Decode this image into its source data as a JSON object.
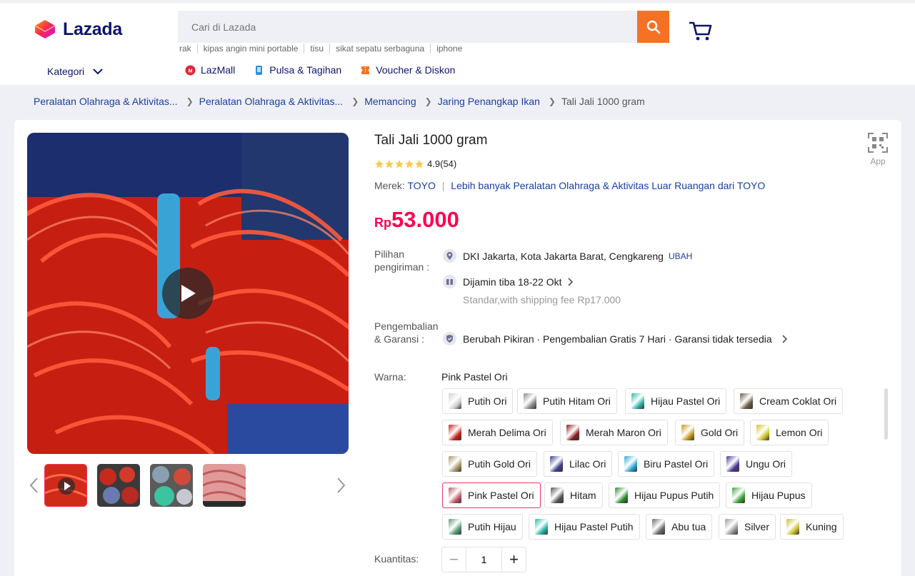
{
  "header": {
    "brand": "Lazada",
    "search": {
      "placeholder": "Cari di Lazada"
    },
    "suggestions": [
      "rak",
      "kipas angin mini portable",
      "tisu",
      "sikat sepatu serbaguna",
      "iphone"
    ],
    "kategori": "Kategori",
    "nav": [
      {
        "label": "LazMall",
        "icon": "lazmall-icon",
        "color": "#e0263a"
      },
      {
        "label": "Pulsa & Tagihan",
        "icon": "phone-icon",
        "color": "#2a8ee8"
      },
      {
        "label": "Voucher & Diskon",
        "icon": "voucher-icon",
        "color": "#f57224"
      }
    ]
  },
  "breadcrumb": [
    "Peralatan Olahraga & Aktivitas...",
    "Peralatan Olahraga & Aktivitas...",
    "Memancing",
    "Jaring Penangkap Ikan",
    "Tali Jali 1000 gram"
  ],
  "product": {
    "title": "Tali Jali 1000 gram",
    "rating_value": 4.9,
    "rating_text": "4.9(54)",
    "brand_label": "Merek:",
    "brand": "TOYO",
    "more_from": "Lebih banyak Peralatan Olahraga & Aktivitas Luar Ruangan dari TOYO",
    "price_currency": "Rp",
    "price_value": "53.000",
    "app_label": "App"
  },
  "delivery": {
    "label": "Pilihan pengiriman :",
    "location": "DKI Jakarta, Kota Jakarta Barat, Cengkareng",
    "change": "UBAH",
    "eta": "Dijamin tiba 18-22 Okt",
    "note": "Standar,with shipping fee Rp17.000"
  },
  "returns": {
    "label": "Pengembalian & Garansi :",
    "text": "Berubah Pikiran · Pengembalian Gratis 7 Hari · Garansi tidak tersedia"
  },
  "color": {
    "label": "Warna:",
    "selected": "Pink Pastel Ori",
    "options": [
      {
        "label": "Putih Ori",
        "swatch": "#cfcfcf"
      },
      {
        "label": "Putih Hitam Ori",
        "swatch": "#8c8c8c"
      },
      {
        "label": "Hijau Pastel Ori",
        "swatch": "#2fb4a5"
      },
      {
        "label": "Cream Coklat Ori",
        "swatch": "#6b5a44"
      },
      {
        "label": "Merah Delima Ori",
        "swatch": "#c8201c"
      },
      {
        "label": "Merah Maron Ori",
        "swatch": "#8e1a20"
      },
      {
        "label": "Gold Ori",
        "swatch": "#c49a18"
      },
      {
        "label": "Lemon Ori",
        "swatch": "#d2c222"
      },
      {
        "label": "Putih Gold Ori",
        "swatch": "#a99a6a"
      },
      {
        "label": "Lilac Ori",
        "swatch": "#3b3f8a"
      },
      {
        "label": "Biru Pastel Ori",
        "swatch": "#2aa9d2"
      },
      {
        "label": "Ungu Ori",
        "swatch": "#4b3496"
      },
      {
        "label": "Pink Pastel Ori",
        "swatch": "#c25a6a"
      },
      {
        "label": "Hitam",
        "swatch": "#555555"
      },
      {
        "label": "Hijau Pupus Putih",
        "swatch": "#2e8c32"
      },
      {
        "label": "Hijau Pupus",
        "swatch": "#3ca23a"
      },
      {
        "label": "Putih Hijau",
        "swatch": "#5a9a78"
      },
      {
        "label": "Hijau Pastel Putih",
        "swatch": "#2ab6a6"
      },
      {
        "label": "Abu tua",
        "swatch": "#6a6a6a"
      },
      {
        "label": "Silver",
        "swatch": "#9a9a9a"
      },
      {
        "label": "Kuning",
        "swatch": "#c8c02a"
      }
    ]
  },
  "quantity": {
    "label": "Kuantitas:",
    "value": "1",
    "minus": "−",
    "plus": "+"
  },
  "colors": {
    "accent": "#f57224",
    "price": "#fe0051",
    "link": "#1a3fa3",
    "nav": "#0f146d"
  }
}
